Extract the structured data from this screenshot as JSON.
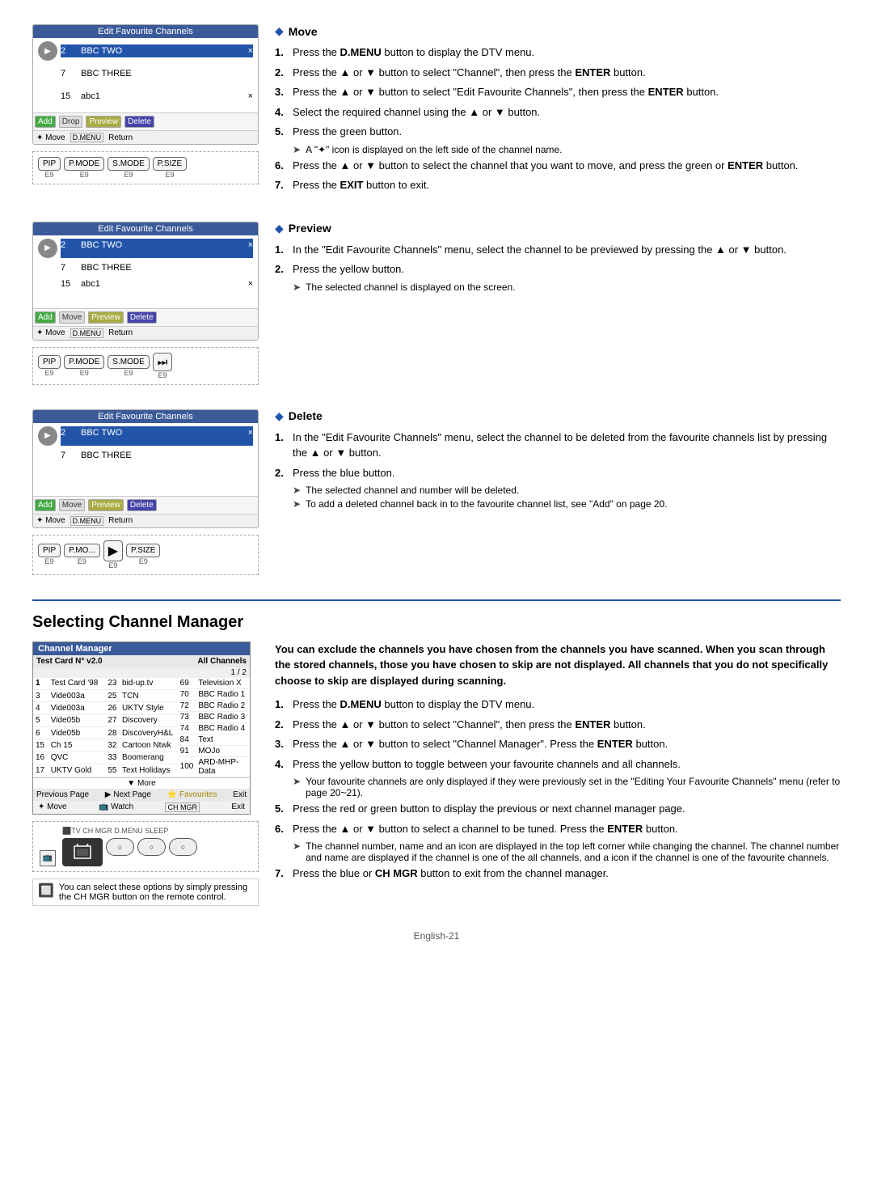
{
  "move_section": {
    "title": "Move",
    "steps": [
      {
        "num": "1.",
        "text": "Press the <b>D.MENU</b> button to display the DTV menu."
      },
      {
        "num": "2.",
        "text": "Press the ▲ or ▼ button to select \"Channel\", then press the <b>ENTER</b> button."
      },
      {
        "num": "3.",
        "text": "Press the ▲ or ▼ button to select \"Edit Favourite Channels\", then press the <b>ENTER</b> button."
      },
      {
        "num": "4.",
        "text": "Select the required channel using the ▲ or ▼ button."
      },
      {
        "num": "5.",
        "text": "Press the green button."
      },
      {
        "num": "6.",
        "text": "Press the ▲ or ▼ button to select the channel that you want to move, and press the green or <b>ENTER</b> button."
      },
      {
        "num": "7.",
        "text": "Press the <b>EXIT</b> button to exit."
      }
    ],
    "notes": [
      "A \"✦\" icon is displayed on the left side of the channel name."
    ],
    "screen_title": "Edit Favourite Channels",
    "channels": [
      {
        "num": "2",
        "name": "BBC TWO",
        "mark": "×"
      },
      {
        "num": "7",
        "name": "BBC THREE",
        "mark": ""
      },
      {
        "num": "15",
        "name": "abc1",
        "mark": "×"
      }
    ],
    "screen_buttons": [
      "Add",
      "Drop",
      "Preview",
      "Delete"
    ],
    "screen_nav": "Move   D.MENU Return",
    "remote_keys": [
      "PIP",
      "P.MODE",
      "S.MODE",
      "P.SIZE"
    ],
    "remote_key_labels": [
      "E9",
      "E9",
      "E9"
    ]
  },
  "preview_section": {
    "title": "Preview",
    "steps": [
      {
        "num": "1.",
        "text": "In the \"Edit Favourite Channels\" menu, select the channel to be previewed by pressing the ▲ or ▼ button."
      },
      {
        "num": "2.",
        "text": "Press the yellow button."
      }
    ],
    "notes": [
      "The selected channel is displayed on the screen."
    ],
    "screen_title": "Edit Favourite Channels",
    "channels": [
      {
        "num": "2",
        "name": "BBC TWO",
        "mark": "×"
      },
      {
        "num": "7",
        "name": "BBC THREE",
        "mark": ""
      },
      {
        "num": "15",
        "name": "abc1",
        "mark": "×"
      }
    ],
    "screen_buttons": [
      "Add",
      "Move",
      "Preview",
      "Delete"
    ],
    "screen_nav": "Move   D.MENU Return",
    "remote_keys": [
      "PIP",
      "P.MODE",
      "S.MODE"
    ],
    "remote_key_labels": [
      "E9",
      "E9",
      "E9"
    ]
  },
  "delete_section": {
    "title": "Delete",
    "steps": [
      {
        "num": "1.",
        "text": "In the \"Edit Favourite Channels\" menu, select the channel to be deleted from the favourite channels list by pressing the ▲ or ▼ button."
      },
      {
        "num": "2.",
        "text": "Press the blue button."
      }
    ],
    "notes": [
      "The selected channel and number will be deleted.",
      "To add a deleted channel back in to the favourite channel list, see \"Add\" on page 20."
    ],
    "screen_title": "Edit Favourite Channels",
    "channels": [
      {
        "num": "2",
        "name": "BBC TWO",
        "mark": "×"
      },
      {
        "num": "7",
        "name": "BBC THREE",
        "mark": ""
      }
    ],
    "screen_buttons": [
      "Add",
      "Move",
      "Preview",
      "Delete"
    ],
    "screen_nav": "Move   D.MENU Return",
    "remote_keys": [
      "PIP",
      "P.MO...",
      "P.SIZE"
    ],
    "remote_key_labels": [
      "E9",
      "E9",
      "E9"
    ]
  },
  "channel_manager_section": {
    "title": "Selecting Channel Manager",
    "intro": "You can exclude the channels you have chosen from the channels you have scanned. When you scan through the stored channels, those you have chosen to skip are not displayed. All channels that you do not specifically choose to skip are displayed during scanning.",
    "steps": [
      {
        "num": "1.",
        "text": "Press the <b>D.MENU</b> button to display the DTV menu."
      },
      {
        "num": "2.",
        "text": "Press the ▲ or ▼ button to select \"Channel\", then press the <b>ENTER</b> button."
      },
      {
        "num": "3.",
        "text": "Press the ▲ or ▼ button to select \"Channel Manager\". Press the <b>ENTER</b> button."
      },
      {
        "num": "4.",
        "text": "Press the yellow button to toggle between your favourite channels and all channels."
      },
      {
        "num": "5.",
        "text": "Press the red or green button to display the previous or next channel manager page."
      },
      {
        "num": "6.",
        "text": "Press the ▲ or ▼ button to select a channel to be tuned. Press the <b>ENTER</b> button."
      },
      {
        "num": "7.",
        "text": "Press the blue or <b>CH MGR</b> button to exit from the channel manager."
      }
    ],
    "notes_4": [
      "Your favourite channels are only displayed if they were previously set in the \"Editing Your Favourite Channels\" menu (refer to page 20~21)."
    ],
    "notes_6": [
      "The channel number, name and an icon are displayed in the top left corner while changing the channel. The channel number and name are displayed if the channel is one of the all channels, and a icon if the channel is one of the favourite channels."
    ],
    "cm_title": "Channel Manager",
    "cm_card": "Test Card N° v2.0",
    "cm_all": "All Channels",
    "cm_page": "1 / 2",
    "cm_channels_col1": [
      {
        "num": "1",
        "name": "Test Card '98"
      },
      {
        "num": "3",
        "name": "Vide003a"
      },
      {
        "num": "4",
        "name": "Vide003a"
      },
      {
        "num": "5",
        "name": "Vide05b"
      },
      {
        "num": "6",
        "name": "Vide05b"
      },
      {
        "num": "15",
        "name": "Ch 15"
      },
      {
        "num": "16",
        "name": "QVC"
      },
      {
        "num": "17",
        "name": "UKTV Gold"
      }
    ],
    "cm_channels_col2": [
      {
        "num": "23",
        "name": "bid-up.tv"
      },
      {
        "num": "25",
        "name": "TCN"
      },
      {
        "num": "26",
        "name": "UKTV Style"
      },
      {
        "num": "27",
        "name": "Discovery"
      },
      {
        "num": "28",
        "name": "DiscoveryH&L"
      },
      {
        "num": "32",
        "name": "Cartoon Ntwk"
      },
      {
        "num": "33",
        "name": "Boomerang"
      },
      {
        "num": "55",
        "name": "Text Holidays"
      }
    ],
    "cm_channels_col3": [
      {
        "num": "69",
        "name": "Television X"
      },
      {
        "num": "70",
        "name": "BBC Radio 1"
      },
      {
        "num": "72",
        "name": "BBC Radio 2"
      },
      {
        "num": "73",
        "name": "BBC Radio 3"
      },
      {
        "num": "74",
        "name": "BBC Radio 4"
      },
      {
        "num": "84",
        "name": "Text"
      },
      {
        "num": "91",
        "name": "MOJo"
      },
      {
        "num": "100",
        "name": "ARD-MHP-Data"
      }
    ],
    "cm_footer_items": [
      "Previous Page",
      "Next Page",
      "Favourites",
      "Exit"
    ],
    "cm_nav": "Move   Watch   CH MGR Exit",
    "note_text": "You can select these options by simply pressing the CH MGR button on the remote control.",
    "remote_labels": [
      "▶▶",
      "○○○"
    ]
  },
  "footer": {
    "text": "English-21"
  }
}
